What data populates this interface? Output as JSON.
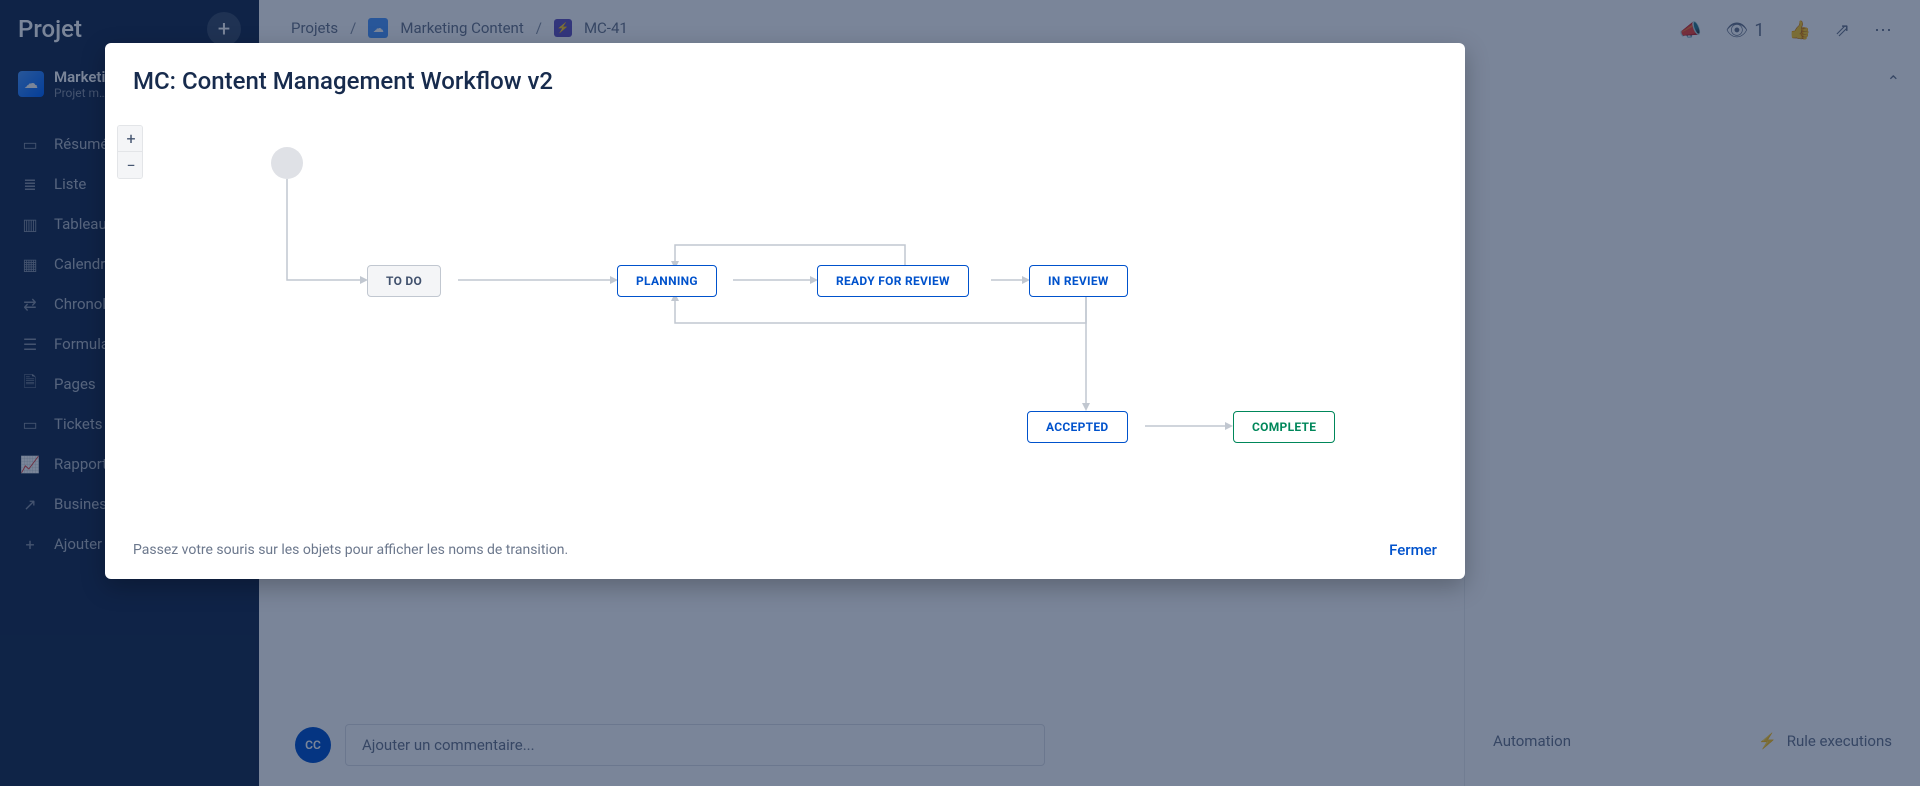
{
  "sidebar": {
    "project_label": "Projet",
    "project_name": "Marketi…",
    "project_sub": "Projet m…",
    "nav": [
      {
        "label": "Résumé",
        "name": "nav-resume",
        "icon": "▭"
      },
      {
        "label": "Liste",
        "name": "nav-liste",
        "icon": "≣"
      },
      {
        "label": "Tableau",
        "name": "nav-tableau",
        "icon": "▥"
      },
      {
        "label": "Calendrier",
        "name": "nav-calendrier",
        "icon": "▦"
      },
      {
        "label": "Chronologie",
        "name": "nav-chrono",
        "icon": "⇄"
      },
      {
        "label": "Formulaires",
        "name": "nav-formulaires",
        "icon": "☰"
      },
      {
        "label": "Pages",
        "name": "nav-pages",
        "icon": "🗎"
      },
      {
        "label": "Tickets",
        "name": "nav-tickets",
        "icon": "▭"
      },
      {
        "label": "Rapports",
        "name": "nav-rapports",
        "icon": "📈"
      },
      {
        "label": "Business projects basics",
        "name": "nav-business",
        "icon": "↗"
      },
      {
        "label": "Ajouter un raccourci",
        "name": "nav-shortcut",
        "icon": "+"
      }
    ]
  },
  "breadcrumb": {
    "projects": "Projets",
    "project": "Marketing Content",
    "issue": "MC-41"
  },
  "header": {
    "watch_count": "1",
    "automation": "Automation",
    "rule_exec": "Rule executions"
  },
  "comment": {
    "avatar": "CC",
    "placeholder": "Ajouter un commentaire..."
  },
  "modal": {
    "title": "MC: Content Management Workflow v2",
    "zoom_in": "+",
    "zoom_out": "−",
    "nodes": {
      "todo": "TO DO",
      "planning": "PLANNING",
      "ready": "READY FOR REVIEW",
      "inreview": "IN REVIEW",
      "accepted": "ACCEPTED",
      "complete": "COMPLETE"
    },
    "hint": "Passez votre souris sur les objets pour afficher les noms de transition.",
    "close": "Fermer"
  }
}
